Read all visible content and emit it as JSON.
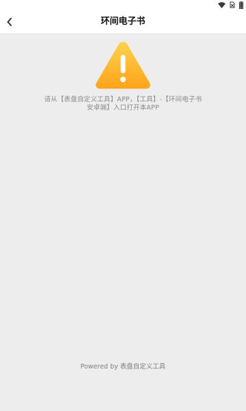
{
  "status_bar": {
    "icons": [
      "wifi-icon",
      "no-sim-icon",
      "battery-icon"
    ]
  },
  "header": {
    "back_icon": "chevron-left-icon",
    "title": "环间电子书"
  },
  "main": {
    "icon": "warning-icon",
    "message_line1": "请从【表盘自定义工具】APP，【工具】-【环间电子书",
    "message_line2": "安卓端】入口打开本APP"
  },
  "footer": {
    "text": "Powered by 表盘自定义工具"
  },
  "colors": {
    "warning_top": "#ffd24d",
    "warning_bottom": "#ffa31a",
    "background": "#ededed",
    "header_bg": "#ffffff"
  }
}
